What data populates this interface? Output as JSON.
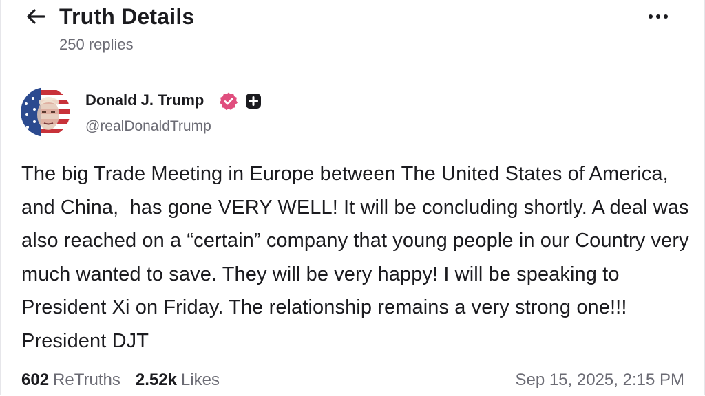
{
  "header": {
    "title": "Truth Details",
    "reply_count": "250 replies"
  },
  "author": {
    "name": "Donald J. Trump",
    "handle": "@realDonaldTrump",
    "verified_color": "#e04e7e"
  },
  "post": {
    "text": "The big Trade Meeting in Europe between The United States of America, and China,  has gone VERY WELL! It will be concluding shortly. A deal was also reached on a “certain” company that young people in our Country very much wanted to save. They will be very happy! I will be speaking to President Xi on Friday. The relationship remains a very strong one!!! President DJT"
  },
  "stats": {
    "retruths_count": "602",
    "retruths_label": "ReTruths",
    "likes_count": "2.52k",
    "likes_label": "Likes",
    "timestamp": "Sep 15, 2025, 2:15 PM"
  },
  "icons": {
    "back": "arrow-left-icon",
    "more": "more-horizontal-icon",
    "verified": "verified-badge-icon",
    "plus": "plus-badge-icon"
  }
}
